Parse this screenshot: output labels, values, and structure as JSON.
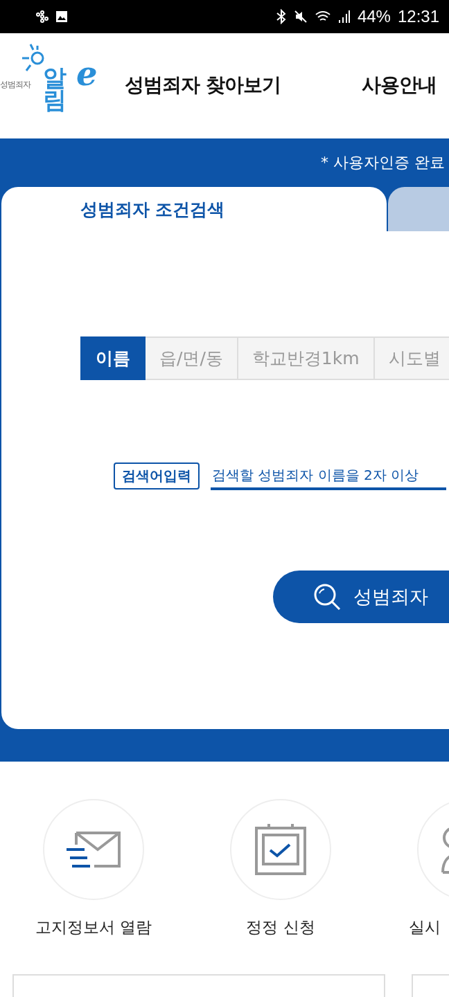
{
  "status_bar": {
    "battery": "44%",
    "time": "12:31"
  },
  "header": {
    "logo": {
      "caption": "성범죄자",
      "wordmark": "알림",
      "suffix": "e"
    },
    "nav": [
      "성범죄자 찾아보기",
      "사용안내"
    ]
  },
  "notice": "* 사용자인증 완료",
  "panel_tabs": [
    {
      "label": "성범죄자 조건검색",
      "selected": true
    },
    {
      "selected": false
    }
  ],
  "search_tabs": [
    {
      "label": "이름",
      "selected": true
    },
    {
      "label": "읍/면/동",
      "selected": false
    },
    {
      "label": "학교반경1km",
      "selected": false
    },
    {
      "label": "시도별",
      "selected": false
    }
  ],
  "search": {
    "label": "검색어입력",
    "placeholder": "검색할 성범죄자 이름을 2자 이상"
  },
  "search_button": "성범죄자",
  "quick_links": [
    {
      "kind": "mail",
      "label": "고지정보서 열람"
    },
    {
      "kind": "calendar",
      "label": "정정 신청"
    },
    {
      "kind": "person",
      "label": "실시"
    }
  ]
}
